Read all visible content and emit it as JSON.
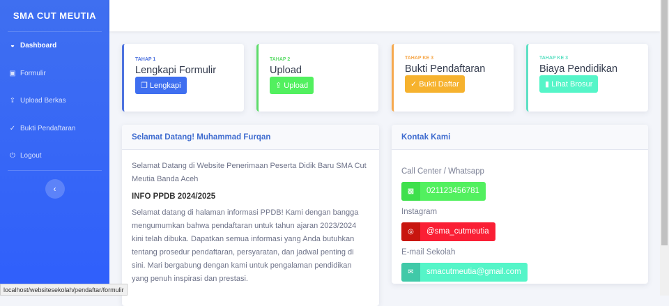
{
  "sidebar": {
    "brand": "SMA CUT MEUTIA",
    "items": [
      {
        "label": "Dashboard"
      },
      {
        "label": "Formulir"
      },
      {
        "label": "Upload Berkas"
      },
      {
        "label": "Bukti Pendaftaran"
      },
      {
        "label": "Logout"
      }
    ]
  },
  "steps": [
    {
      "label": "TAHAP 1",
      "title": "Lengkapi Formulir",
      "button": "Lengkapi",
      "color": "#4e73df",
      "btn_color": "#3f6ff0"
    },
    {
      "label": "TAHAP 2",
      "title": "Upload",
      "button": "Upload",
      "color": "#5ddc6a",
      "btn_color": "#52f05f"
    },
    {
      "label": "TAHAP KE 3",
      "title": "Bukti Pendaftaran",
      "button": "Bukti Daftar",
      "color": "#f6a94e",
      "btn_color": "#f6b22e"
    },
    {
      "label": "TAHAP KE 3",
      "title": "Biaya Pendidikan",
      "button": "Lihat Brosur",
      "color": "#5fe0c4",
      "btn_color": "#55f5c8"
    }
  ],
  "welcome": {
    "title": "Selamat Datang! Muhammad Furqan",
    "intro": "Selamat Datang di Website Penerimaan Peserta Didik Baru SMA Cut Meutia Banda Aceh",
    "heading": "INFO PPDB 2024/2025",
    "body": "Selamat datang di halaman informasi PPDB! Kami dengan bangga mengumumkan bahwa pendaftaran untuk tahun ajaran 2023/2024 kini telah dibuka. Dapatkan semua informasi yang Anda butuhkan tentang prosedur pendaftaran, persyaratan, dan jadwal penting di sini. Mari bergabung dengan kami untuk pengalaman pendidikan yang penuh inspirasi dan prestasi."
  },
  "contact": {
    "title": "Kontak Kami",
    "items": [
      {
        "label": "Call Center / Whatsapp",
        "value": "021123456781"
      },
      {
        "label": "Instagram",
        "value": "@sma_cutmeutia"
      },
      {
        "label": "E-mail Sekolah",
        "value": "smacutmeutia@gmail.com"
      }
    ]
  },
  "status_url": "localhost/websitesekolah/pendaftar/formulir"
}
